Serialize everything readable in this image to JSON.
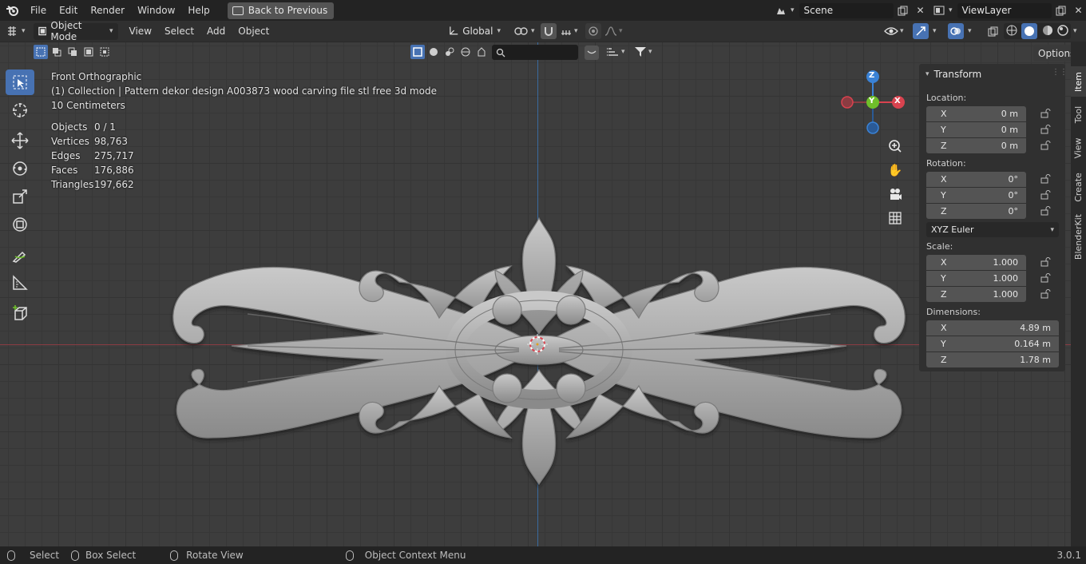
{
  "menu": {
    "file": "File",
    "edit": "Edit",
    "render": "Render",
    "window": "Window",
    "help": "Help",
    "back_to_previous": "Back to Previous"
  },
  "scene": {
    "name": "Scene",
    "view_layer": "ViewLayer"
  },
  "header": {
    "mode": "Object Mode",
    "view": "View",
    "select": "Select",
    "add": "Add",
    "object": "Object",
    "orientation": "Global",
    "options": "Options"
  },
  "overlay": {
    "view_name": "Front Orthographic",
    "collection": "(1) Collection | Pattern dekor design A003873 wood carving file stl free 3d mode",
    "scale": "10 Centimeters",
    "stats": [
      {
        "label": "Objects",
        "value": "0 / 1"
      },
      {
        "label": "Vertices",
        "value": "98,763"
      },
      {
        "label": "Edges",
        "value": "275,717"
      },
      {
        "label": "Faces",
        "value": "176,886"
      },
      {
        "label": "Triangles",
        "value": "197,662"
      }
    ]
  },
  "gizmo": {
    "z": "Z",
    "y": "Y",
    "x": "X"
  },
  "panel": {
    "title": "Transform",
    "location_label": "Location:",
    "location": [
      {
        "axis": "X",
        "value": "0 m"
      },
      {
        "axis": "Y",
        "value": "0 m"
      },
      {
        "axis": "Z",
        "value": "0 m"
      }
    ],
    "rotation_label": "Rotation:",
    "rotation": [
      {
        "axis": "X",
        "value": "0°"
      },
      {
        "axis": "Y",
        "value": "0°"
      },
      {
        "axis": "Z",
        "value": "0°"
      }
    ],
    "rotation_mode": "XYZ Euler",
    "scale_label": "Scale:",
    "scale": [
      {
        "axis": "X",
        "value": "1.000"
      },
      {
        "axis": "Y",
        "value": "1.000"
      },
      {
        "axis": "Z",
        "value": "1.000"
      }
    ],
    "dimensions_label": "Dimensions:",
    "dimensions": [
      {
        "axis": "X",
        "value": "4.89 m"
      },
      {
        "axis": "Y",
        "value": "0.164 m"
      },
      {
        "axis": "Z",
        "value": "1.78 m"
      }
    ]
  },
  "side_tabs": [
    "Item",
    "Tool",
    "View",
    "Create",
    "BlenderKit"
  ],
  "status": {
    "select": "Select",
    "box_select": "Box Select",
    "rotate_view": "Rotate View",
    "context_menu": "Object Context Menu",
    "version": "3.0.1"
  },
  "colors": {
    "accent": "#4772b3",
    "x_axis": "#d9434f",
    "y_axis": "#6fc02a",
    "z_axis": "#3a82d6"
  }
}
